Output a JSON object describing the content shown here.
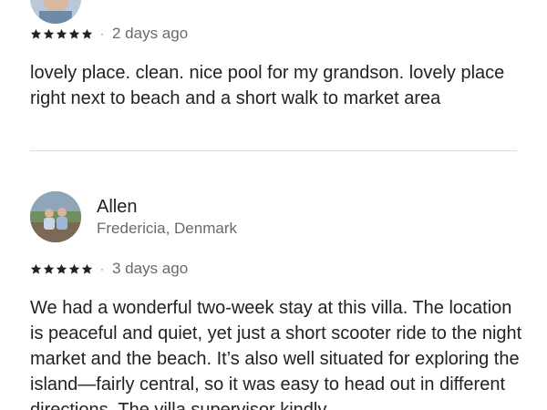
{
  "reviews": [
    {
      "name": "",
      "location": "",
      "rating": 5,
      "date": "2 days ago",
      "text": "lovely place.  clean. nice pool for my grandson. lovely place right next to beach and a short walk to market area"
    },
    {
      "name": "Allen",
      "location": "Fredericia, Denmark",
      "rating": 5,
      "date": "3 days ago",
      "text": "We had a wonderful two-week stay at this villa. The location is peaceful and quiet, yet just a short scooter ride to the night market and the beach. It’s also well situated for exploring the island—fairly central, so it was easy to head out in different directions. The villa supervisor kindly"
    }
  ],
  "icons": {
    "star": "star-icon",
    "separator": "middle-dot"
  },
  "colors": {
    "text": "#222222",
    "secondary_text": "#6a6a6a",
    "divider": "#dddddd"
  },
  "separator_glyph": "·"
}
